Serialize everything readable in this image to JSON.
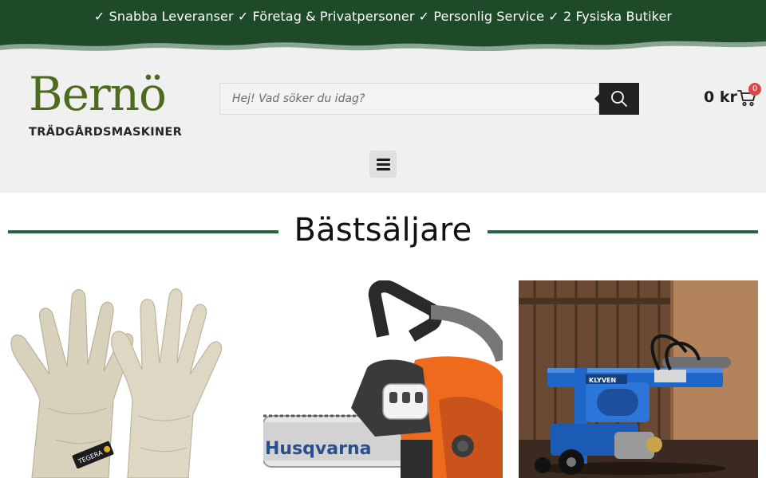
{
  "banner": {
    "text": "✓ Snabba Leveranser  ✓ Företag & Privatpersoner ✓ Personlig Service ✓ 2 Fysiska Butiker"
  },
  "header": {
    "logo": {
      "word": "Bernö",
      "subtitle": "TRÄDGÅRDSMASKINER"
    },
    "search": {
      "placeholder": "Hej! Vad söker du idag?",
      "value": ""
    },
    "cart": {
      "total": "0 kr",
      "count": "0"
    },
    "menu_icon": "hamburger-icon"
  },
  "section": {
    "title": "Bästsäljare"
  },
  "products": [
    {
      "image": "gardening-gloves",
      "brand_label": "TEGERA"
    },
    {
      "image": "husqvarna-chainsaw",
      "brand_label": "Husqvarna"
    },
    {
      "image": "log-splitter",
      "brand_label": "KLYVEN"
    }
  ],
  "colors": {
    "banner_green": "#1f4a2a",
    "accent_green": "#226640",
    "logo_green": "#4d6b1f",
    "header_bg": "#f0f0f0",
    "badge_red": "#d84a4a"
  }
}
